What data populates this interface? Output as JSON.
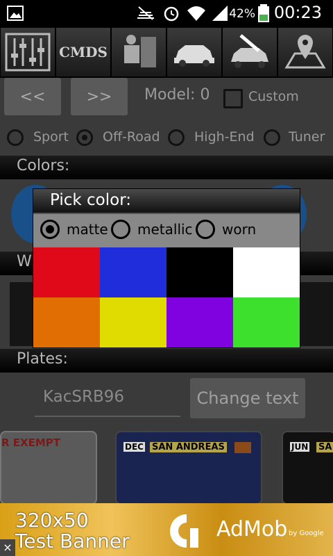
{
  "status": {
    "battery_pct": "42%",
    "time": "00:23"
  },
  "toolbar": {
    "cmds_label": "CMDS"
  },
  "nav": {
    "prev_label": "<<",
    "next_label": ">>",
    "model_label": "Model: 0",
    "custom_label": "Custom"
  },
  "types": [
    {
      "label": "Sport",
      "selected": false
    },
    {
      "label": "Off-Road",
      "selected": true
    },
    {
      "label": "High-End",
      "selected": false
    },
    {
      "label": "Tuner",
      "selected": false
    }
  ],
  "sections": {
    "colors": "Colors:",
    "wheels": "W",
    "plates": "Plates:"
  },
  "plate": {
    "text": "KacSRB96",
    "change_label": "Change text",
    "plate1_text": "R EXEMPT",
    "plate2_dec": "DEC",
    "plate2_state": "SAN ANDREAS",
    "plate3_jun": "JUN",
    "plate3_state": "SA"
  },
  "dialog": {
    "title": "Pick color:",
    "options": [
      {
        "label": "matte",
        "selected": true
      },
      {
        "label": "metallic",
        "selected": false
      },
      {
        "label": "worn",
        "selected": false
      }
    ],
    "colors": [
      "#e0091a",
      "#1f2ddb",
      "#000000",
      "#ffffff",
      "#e06e02",
      "#e0dc02",
      "#8102e0",
      "#3ce02d"
    ]
  },
  "ad": {
    "line1": "320x50",
    "line2": "Test Banner",
    "brand": "AdMob",
    "by": "by Google",
    "close": "×"
  }
}
